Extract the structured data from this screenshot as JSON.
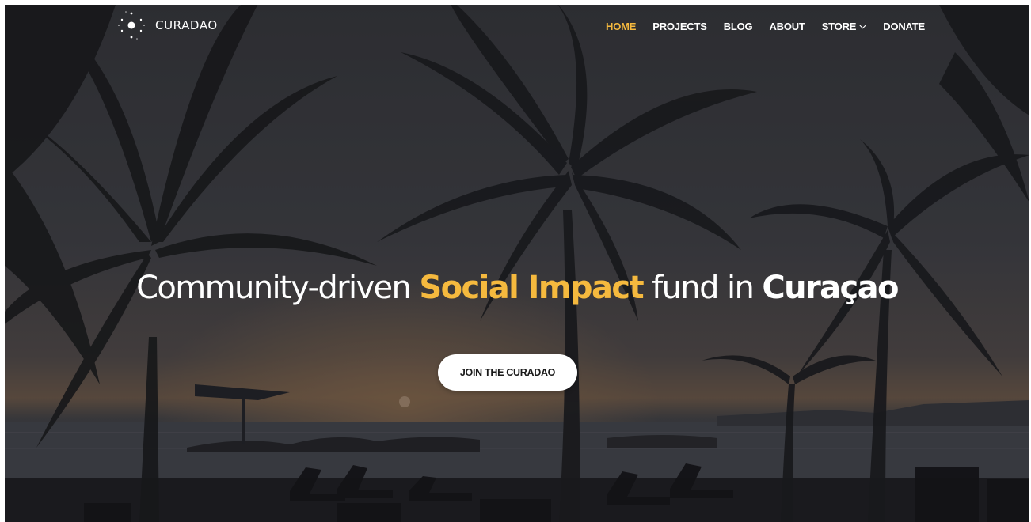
{
  "brand": {
    "name": "CURADAO",
    "logo_icon": "constellation-dots-icon"
  },
  "nav": {
    "items": [
      {
        "label": "HOME",
        "active": true
      },
      {
        "label": "PROJECTS",
        "active": false
      },
      {
        "label": "BLOG",
        "active": false
      },
      {
        "label": "ABOUT",
        "active": false
      },
      {
        "label": "STORE",
        "active": false,
        "icon": "chevron-down-icon"
      },
      {
        "label": "DONATE",
        "active": false
      }
    ]
  },
  "hero": {
    "title_part1": "Community-driven ",
    "title_accent": "Social Impact",
    "title_part2": " fund in ",
    "title_bold": "Curaçao",
    "cta_label": "JOIN THE CURADAO"
  },
  "colors": {
    "accent": "#f5b93e",
    "text": "#ffffff",
    "button_bg": "#ffffff",
    "button_text": "#1a1a1a"
  }
}
